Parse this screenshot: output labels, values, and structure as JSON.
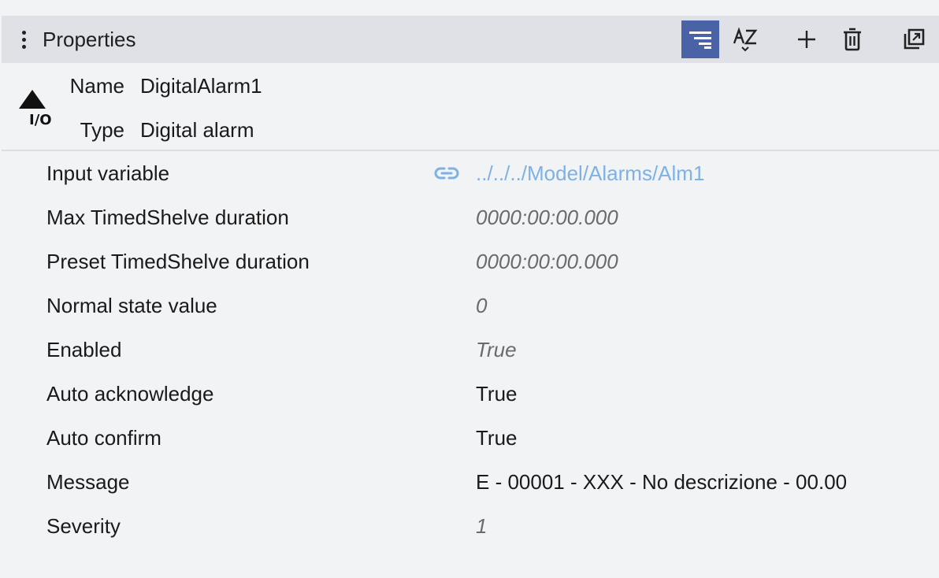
{
  "header": {
    "title": "Properties",
    "tools": [
      {
        "name": "filter-sort-button",
        "icon": "filter-lines-icon",
        "active": true
      },
      {
        "name": "alpha-sort-button",
        "icon": "az-sort-icon",
        "active": false
      },
      {
        "name": "add-button",
        "icon": "plus-icon",
        "active": false
      },
      {
        "name": "delete-button",
        "icon": "trash-icon",
        "active": false
      },
      {
        "name": "open-external-button",
        "icon": "open-external-icon",
        "active": false
      }
    ]
  },
  "object": {
    "icon": "io-alarm-icon",
    "name_label": "Name",
    "name_value": "DigitalAlarm1",
    "type_label": "Type",
    "type_value": "Digital alarm"
  },
  "properties": [
    {
      "label": "Input variable",
      "value": "../../../Model/Alarms/Alm1",
      "kind": "link"
    },
    {
      "label": "Max TimedShelve duration",
      "value": "0000:00:00.000",
      "kind": "inherited"
    },
    {
      "label": "Preset TimedShelve duration",
      "value": "0000:00:00.000",
      "kind": "inherited"
    },
    {
      "label": "Normal state value",
      "value": "0",
      "kind": "inherited"
    },
    {
      "label": "Enabled",
      "value": "True",
      "kind": "inherited"
    },
    {
      "label": "Auto acknowledge",
      "value": "True",
      "kind": "set"
    },
    {
      "label": "Auto confirm",
      "value": "True",
      "kind": "set"
    },
    {
      "label": "Message",
      "value": "E - 00001 - XXX - No descrizione - 00.00",
      "kind": "set"
    },
    {
      "label": "Severity",
      "value": "1",
      "kind": "inherited"
    }
  ],
  "colors": {
    "header_bg": "#dfe1e6",
    "active_tool": "#4a62a6",
    "link": "#7fb1e3",
    "inherited_value": "#6b6b6b"
  }
}
